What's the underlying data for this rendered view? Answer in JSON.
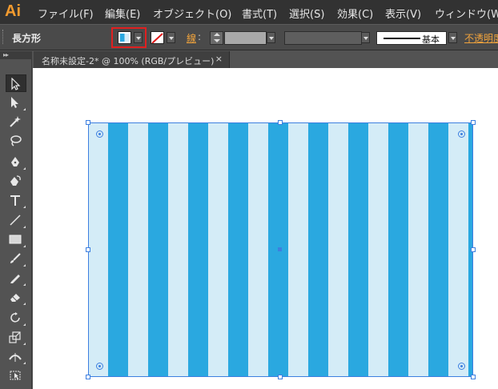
{
  "app": {
    "logo": "Ai",
    "brand_color": "#f29b2f"
  },
  "menubar": {
    "items": [
      {
        "label": "ファイル(F)"
      },
      {
        "label": "編集(E)"
      },
      {
        "label": "オブジェクト(O)"
      },
      {
        "label": "書式(T)"
      },
      {
        "label": "選択(S)"
      },
      {
        "label": "効果(C)"
      },
      {
        "label": "表示(V)"
      },
      {
        "label": "ウィンドウ(W)"
      }
    ]
  },
  "controlbar": {
    "object_type": "長方形",
    "fill": {
      "icon": "pattern-swatch-icon",
      "highlight_color": "#e02020"
    },
    "stroke": {
      "icon": "none-swatch-icon"
    },
    "stroke_label": "線",
    "stroke_colon": ":",
    "brush_label": "基本",
    "opacity_label": "不透明度"
  },
  "tools": [
    {
      "name": "selection-tool-icon"
    },
    {
      "name": "direct-selection-tool-icon"
    },
    {
      "name": "magic-wand-tool-icon"
    },
    {
      "name": "lasso-tool-icon"
    },
    {
      "name": "pen-tool-icon"
    },
    {
      "name": "curvature-tool-icon"
    },
    {
      "name": "type-tool-icon"
    },
    {
      "name": "line-segment-tool-icon"
    },
    {
      "name": "rectangle-tool-icon"
    },
    {
      "name": "paintbrush-tool-icon"
    },
    {
      "name": "pencil-tool-icon"
    },
    {
      "name": "eraser-tool-icon"
    },
    {
      "name": "rotate-tool-icon"
    },
    {
      "name": "scale-tool-icon"
    },
    {
      "name": "width-tool-icon"
    },
    {
      "name": "free-transform-tool-icon"
    }
  ],
  "document": {
    "tab_label": "名称未設定-2* @ 100% (RGB/プレビュー)",
    "close_glyph": "×"
  },
  "canvas": {
    "stripe_colors": {
      "light": "#d4ecf7",
      "dark": "#2aa8e0"
    },
    "selection_color": "#3d7fe0"
  }
}
